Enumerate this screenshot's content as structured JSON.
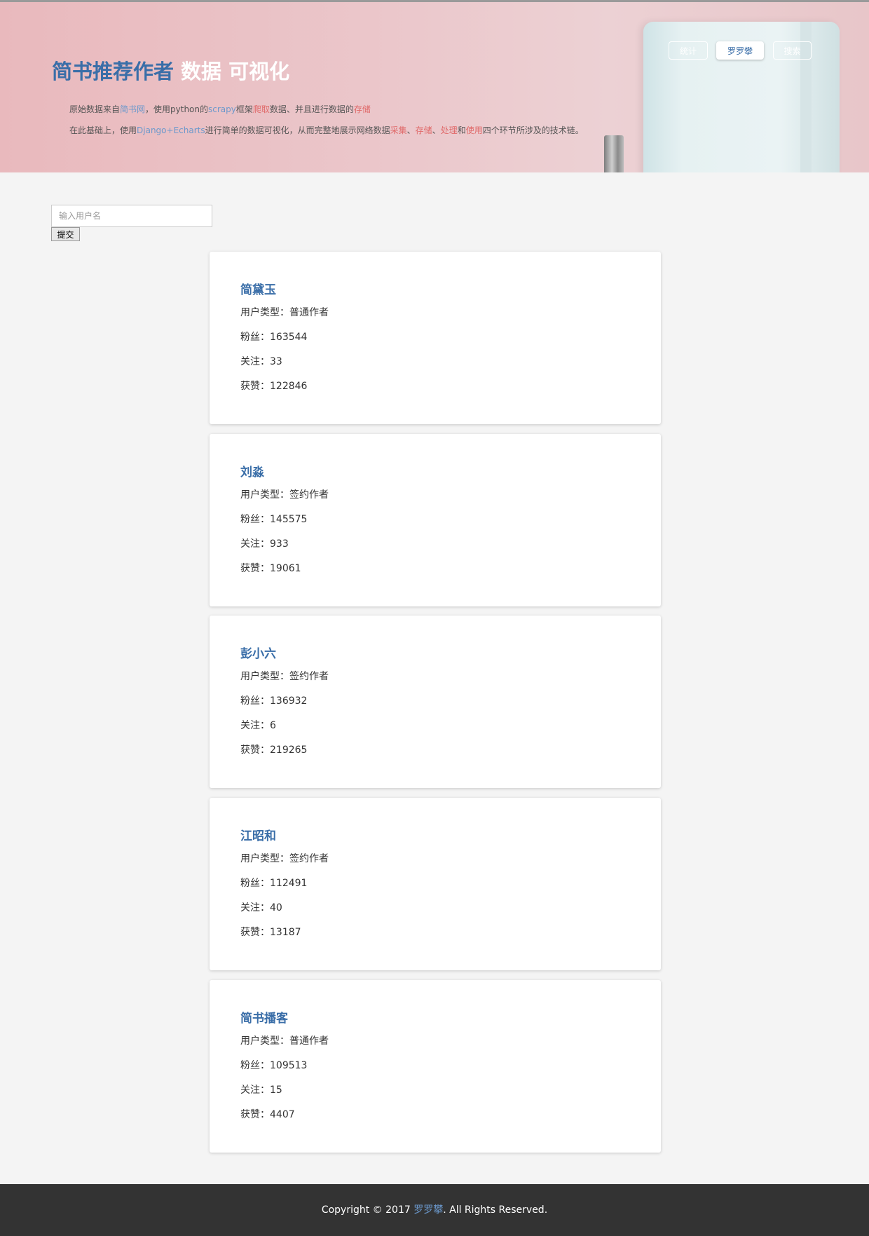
{
  "header": {
    "title_main": "简书推荐作者",
    "title_sub": "数据 可视化",
    "line1": {
      "p1": "原始数据来自",
      "link": "简书网",
      "p2": "，使用python的",
      "tool": "scrapy",
      "p3": "框架",
      "action1": "爬取",
      "p4": "数据、并且进行数据的",
      "action2": "存储"
    },
    "line2": {
      "p1": "在此基础上，使用",
      "tool": "Django+Echarts",
      "p2": "进行简单的数据可视化，从而完整地展示网络数据",
      "s1": "采集",
      "sep1": "、",
      "s2": "存储",
      "sep2": "、",
      "s3": "处理",
      "and": "和",
      "s4": "使用",
      "p3": "四个环节所涉及的技术链。"
    },
    "nav": [
      {
        "label": "统计",
        "active": false
      },
      {
        "label": "罗罗攀",
        "active": true
      },
      {
        "label": "搜索",
        "active": false
      }
    ]
  },
  "search": {
    "placeholder": "输入用户名",
    "value": "",
    "submit_label": "提交"
  },
  "field_labels": {
    "type": "用户类型：",
    "fans": "粉丝：",
    "follow": "关注：",
    "likes": "获赞："
  },
  "authors": [
    {
      "name": "简黛玉",
      "type": "普通作者",
      "fans": "163544",
      "follow": "33",
      "likes": "122846"
    },
    {
      "name": "刘淼",
      "type": "签约作者",
      "fans": "145575",
      "follow": "933",
      "likes": "19061"
    },
    {
      "name": "彭小六",
      "type": "签约作者",
      "fans": "136932",
      "follow": "6",
      "likes": "219265"
    },
    {
      "name": "江昭和",
      "type": "签约作者",
      "fans": "112491",
      "follow": "40",
      "likes": "13187"
    },
    {
      "name": "简书播客",
      "type": "普通作者",
      "fans": "109513",
      "follow": "15",
      "likes": "4407"
    }
  ],
  "footer": {
    "prefix": "Copyright © 2017 ",
    "author": "罗罗攀",
    "suffix": ". All Rights Reserved."
  },
  "colors": {
    "accent_blue": "#3a6ea8",
    "link_blue": "#6b98cc",
    "highlight_red": "#e06a6a",
    "footer_bg": "#333333"
  }
}
